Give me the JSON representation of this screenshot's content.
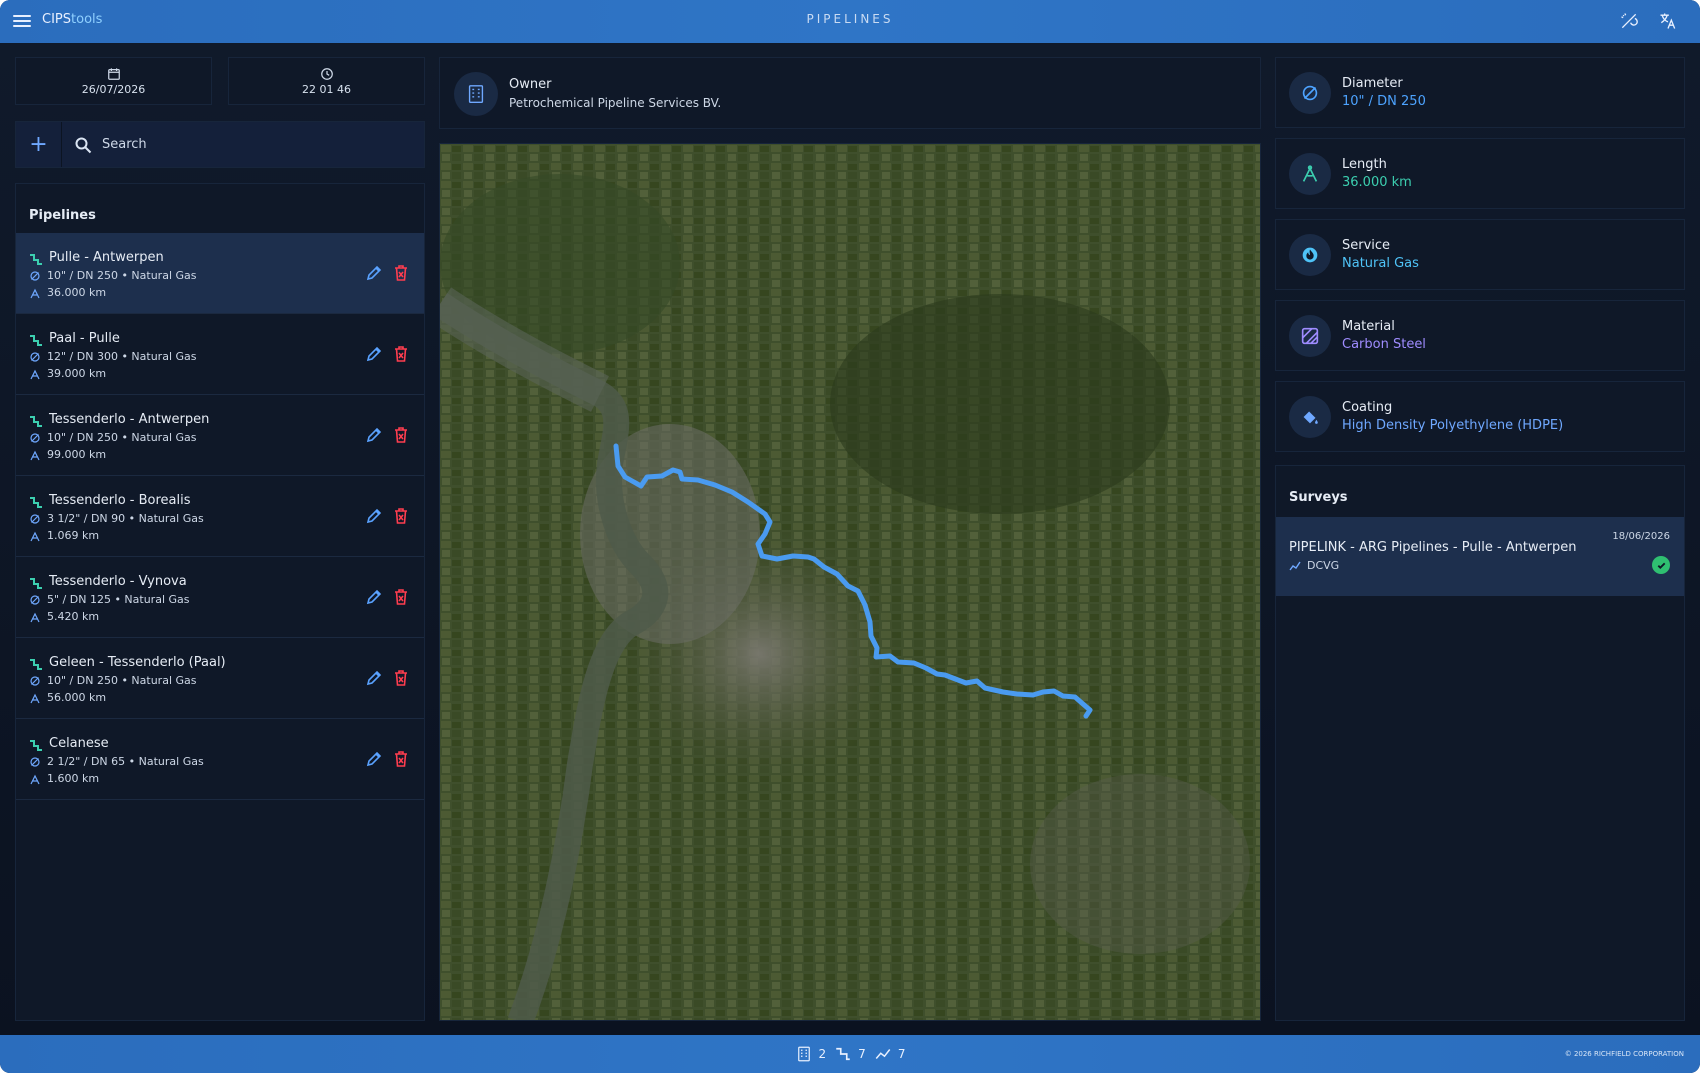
{
  "app": {
    "brand_part1": "CIPS",
    "brand_part2": "tools",
    "page_title": "PIPELINES"
  },
  "datetime": {
    "date": "26/07/2026",
    "time": "22 01 46"
  },
  "search": {
    "placeholder": "Search"
  },
  "pipelines": {
    "title": "Pipelines",
    "items": [
      {
        "name": "Pulle - Antwerpen",
        "meta": "10\" / DN 250 • Natural Gas",
        "length": "36.000 km"
      },
      {
        "name": "Paal - Pulle",
        "meta": "12\" / DN 300 • Natural Gas",
        "length": "39.000 km"
      },
      {
        "name": "Tessenderlo - Antwerpen",
        "meta": "10\" / DN 250 • Natural Gas",
        "length": "99.000 km"
      },
      {
        "name": "Tessenderlo - Borealis",
        "meta": "3 1/2\" / DN 90 • Natural Gas",
        "length": "1.069 km"
      },
      {
        "name": "Tessenderlo - Vynova",
        "meta": "5\" / DN 125 • Natural Gas",
        "length": "5.420 km"
      },
      {
        "name": "Geleen - Tessenderlo (Paal)",
        "meta": "10\" / DN 250 • Natural Gas",
        "length": "56.000 km"
      },
      {
        "name": "Celanese",
        "meta": "2 1/2\" / DN 65 • Natural Gas",
        "length": "1.600 km"
      }
    ]
  },
  "owner": {
    "label": "Owner",
    "value": "Petrochemical Pipeline Services BV."
  },
  "properties": {
    "diameter": {
      "label": "Diameter",
      "value": "10\" / DN 250",
      "icon": "diameter-icon",
      "color": "#4da3ff"
    },
    "length": {
      "label": "Length",
      "value": "36.000 km",
      "icon": "length-icon",
      "color": "#3ccfb0"
    },
    "service": {
      "label": "Service",
      "value": "Natural Gas",
      "icon": "flame-icon",
      "color": "#4fc3f7"
    },
    "material": {
      "label": "Material",
      "value": "Carbon Steel",
      "icon": "material-icon",
      "color": "#9f8cff"
    },
    "coating": {
      "label": "Coating",
      "value": "High Density Polyethylene (HDPE)",
      "icon": "paint-bucket-icon",
      "color": "#6fa8ff"
    }
  },
  "surveys": {
    "title": "Surveys",
    "items": [
      {
        "name": "PIPELINK - ARG Pipelines - Pulle - Antwerpen",
        "type": "DCVG",
        "date": "18/06/2026",
        "status": "complete"
      }
    ]
  },
  "stats": {
    "owners": "2",
    "pipelines": "7",
    "surveys": "7"
  },
  "footer": {
    "copyright": "© 2026 RICHFIELD CORPORATION"
  },
  "colors": {
    "accent": "#2f75c6",
    "route": "#4a9bf0",
    "delete": "#ff3d4f",
    "edit": "#5aa2ff",
    "success": "#2fbf71"
  }
}
